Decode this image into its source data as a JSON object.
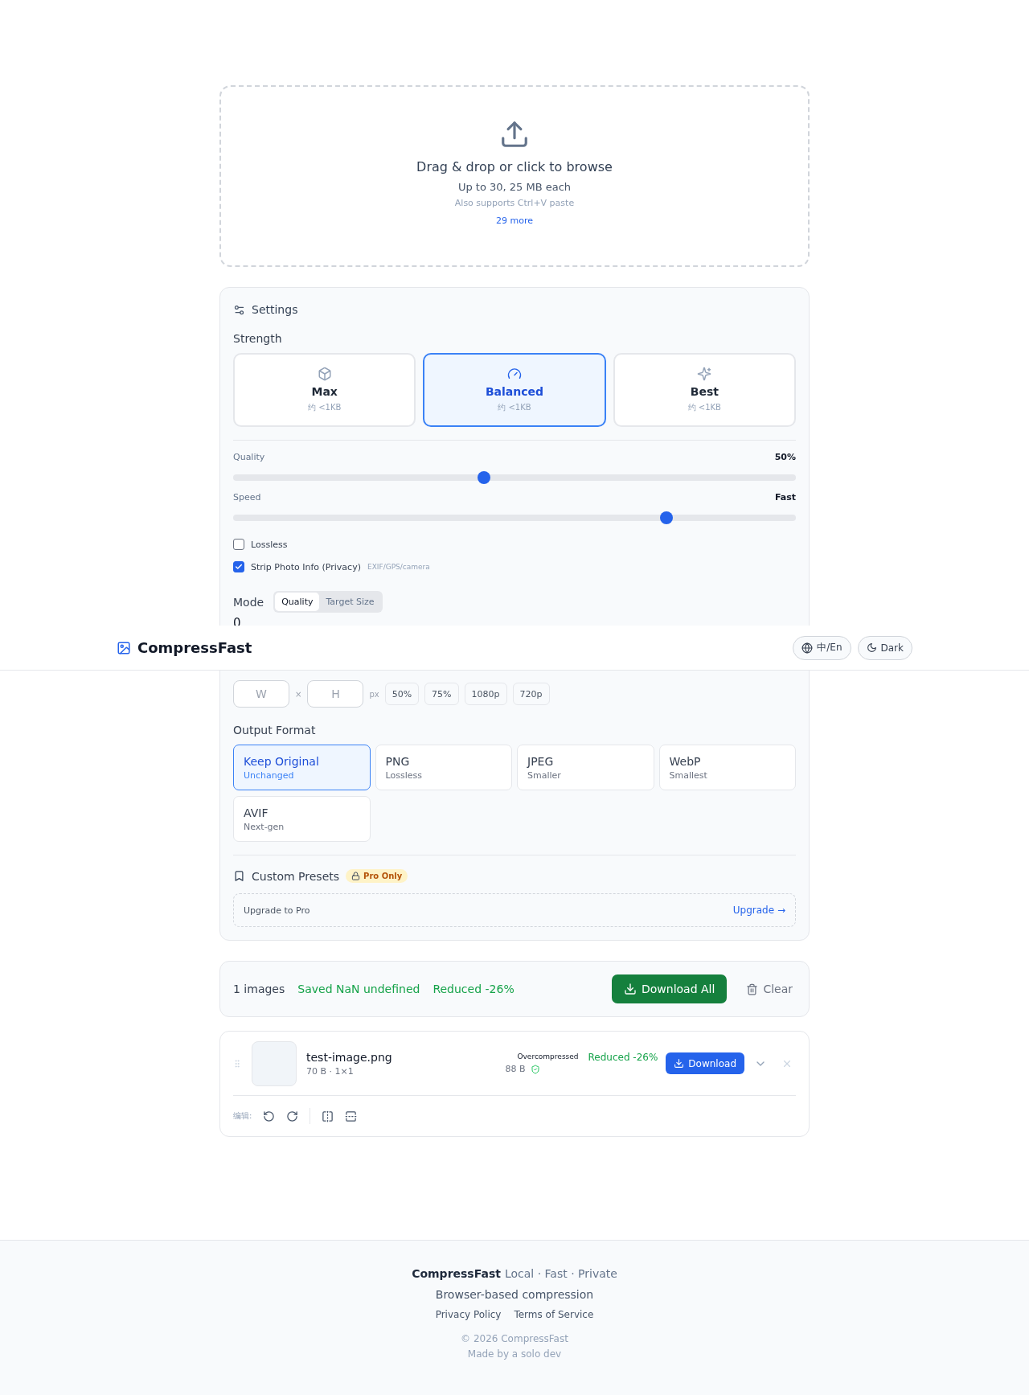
{
  "header": {
    "logo": "CompressFast",
    "language_button": "中/En",
    "theme_button": "Dark"
  },
  "dropzone": {
    "title": "Drag & drop or click to browse",
    "limit": "Up to 30, 25 MB each",
    "hint": "Also supports Ctrl+V paste",
    "more_link": "29 more"
  },
  "settings": {
    "title": "Settings",
    "strength_label": "Strength",
    "strength_options": [
      {
        "label": "Max",
        "estimate": "约 <1KB",
        "selected": false
      },
      {
        "label": "Balanced",
        "estimate": "约 <1KB",
        "selected": true
      },
      {
        "label": "Best",
        "estimate": "约 <1KB",
        "selected": false
      }
    ],
    "sliders": [
      {
        "label": "Quality",
        "reading": "50%",
        "level": 0.445
      },
      {
        "label": "Speed",
        "reading": "Fast",
        "level": 0.77
      }
    ],
    "options": [
      {
        "label": "Lossless",
        "checked": false
      },
      {
        "label": "Strip Photo Info (Privacy)",
        "note": "EXIF/GPS/camera",
        "checked": true
      }
    ],
    "mode": {
      "label": "Mode",
      "options": [
        {
          "label": "Quality",
          "selected": true
        },
        {
          "label": "Target Size",
          "selected": false
        }
      ],
      "value": "0"
    },
    "resize": {
      "width_placeholder": "W",
      "separator": "×",
      "height_placeholder": "H",
      "unit": "px",
      "presets": [
        "50%",
        "75%",
        "1080p",
        "720p"
      ]
    },
    "output_format": {
      "label": "Output Format",
      "options": [
        {
          "label": "Keep Original",
          "note": "Unchanged",
          "selected": true
        },
        {
          "label": "PNG",
          "note": "Lossless",
          "selected": false
        },
        {
          "label": "JPEG",
          "note": "Smaller",
          "selected": false
        },
        {
          "label": "WebP",
          "note": "Smallest",
          "selected": false
        },
        {
          "label": "AVIF",
          "note": "Next-gen",
          "selected": false
        }
      ]
    },
    "custom_presets": {
      "title": "Custom Presets",
      "badge": "Pro Only",
      "prompt": "Upgrade to Pro",
      "link": "Upgrade →"
    }
  },
  "summary": {
    "count": "1 images",
    "saved": "Saved NaN undefined",
    "reduced": "Reduced -26%",
    "download_all": "Download All",
    "clear": "Clear"
  },
  "files": [
    {
      "name": "test-image.png",
      "meta": "70 B · 1×1",
      "status": "Overcompressed",
      "new_size": "88 B",
      "reduced": "Reduced -26%",
      "download": "Download",
      "edit_label": "编辑:"
    }
  ],
  "footer": {
    "brand": "CompressFast",
    "tagline": "Local · Fast · Private",
    "subtitle": "Browser-based compression",
    "links": [
      "Privacy Policy",
      "Terms of Service"
    ],
    "copyright": "© 2026 CompressFast",
    "credit": "Made by a solo dev"
  }
}
